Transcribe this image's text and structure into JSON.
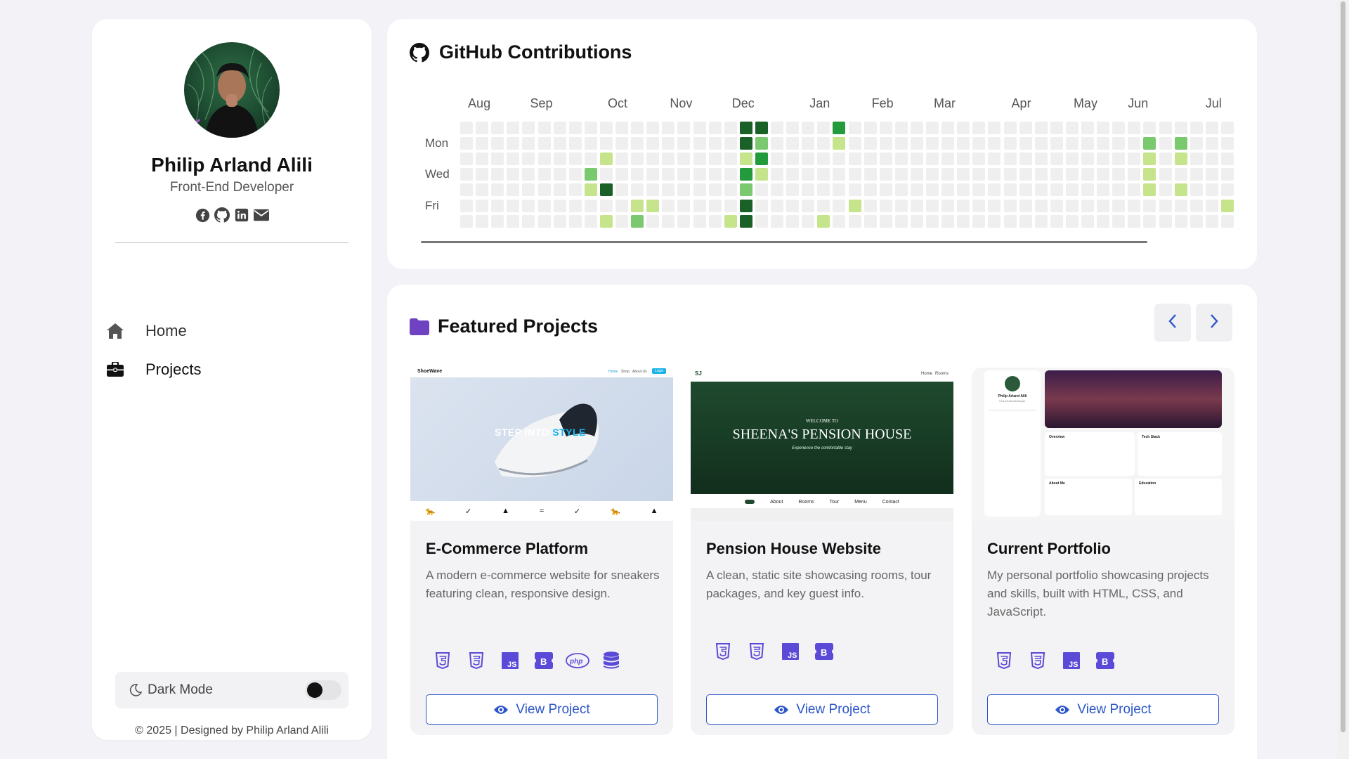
{
  "profile": {
    "name": "Philip Arland Alili",
    "role": "Front-End Developer"
  },
  "nav": {
    "home": "Home",
    "projects": "Projects"
  },
  "dark_mode": {
    "label": "Dark Mode",
    "enabled": false
  },
  "copyright": "© 2025 | Designed by Philip Arland Alili",
  "github": {
    "title": "GitHub Contributions",
    "months": [
      "Aug",
      "Sep",
      "Oct",
      "Nov",
      "Dec",
      "Jan",
      "Feb",
      "Mar",
      "Apr",
      "May",
      "Jun",
      "Jul"
    ],
    "days": [
      "Mon",
      "Wed",
      "Fri"
    ],
    "weeks": 50,
    "contributions": [
      {
        "w": 8,
        "d": 3,
        "l": 2
      },
      {
        "w": 8,
        "d": 4,
        "l": 1
      },
      {
        "w": 9,
        "d": 2,
        "l": 1
      },
      {
        "w": 9,
        "d": 4,
        "l": 4
      },
      {
        "w": 9,
        "d": 6,
        "l": 1
      },
      {
        "w": 11,
        "d": 5,
        "l": 1
      },
      {
        "w": 11,
        "d": 6,
        "l": 2
      },
      {
        "w": 12,
        "d": 5,
        "l": 1
      },
      {
        "w": 17,
        "d": 6,
        "l": 1
      },
      {
        "w": 18,
        "d": 0,
        "l": 4
      },
      {
        "w": 18,
        "d": 1,
        "l": 4
      },
      {
        "w": 18,
        "d": 2,
        "l": 1
      },
      {
        "w": 18,
        "d": 3,
        "l": 3
      },
      {
        "w": 18,
        "d": 4,
        "l": 2
      },
      {
        "w": 18,
        "d": 5,
        "l": 4
      },
      {
        "w": 18,
        "d": 6,
        "l": 4
      },
      {
        "w": 19,
        "d": 0,
        "l": 4
      },
      {
        "w": 19,
        "d": 1,
        "l": 2
      },
      {
        "w": 19,
        "d": 2,
        "l": 3
      },
      {
        "w": 19,
        "d": 3,
        "l": 1
      },
      {
        "w": 23,
        "d": 6,
        "l": 1
      },
      {
        "w": 24,
        "d": 0,
        "l": 3
      },
      {
        "w": 24,
        "d": 1,
        "l": 1
      },
      {
        "w": 25,
        "d": 5,
        "l": 1
      },
      {
        "w": 44,
        "d": 1,
        "l": 2
      },
      {
        "w": 44,
        "d": 2,
        "l": 1
      },
      {
        "w": 44,
        "d": 3,
        "l": 1
      },
      {
        "w": 44,
        "d": 4,
        "l": 1
      },
      {
        "w": 46,
        "d": 1,
        "l": 2
      },
      {
        "w": 46,
        "d": 2,
        "l": 1
      },
      {
        "w": 46,
        "d": 4,
        "l": 1
      },
      {
        "w": 49,
        "d": 5,
        "l": 1
      }
    ],
    "level_colors": [
      "#efefef",
      "#c6e48b",
      "#7bc96f",
      "#239a3b",
      "#196127"
    ]
  },
  "projects": {
    "title": "Featured Projects",
    "view_label": "View Project",
    "items": [
      {
        "title": "E-Commerce Platform",
        "description": "A modern e-commerce website for sneakers featuring clean, responsive design.",
        "tech": [
          "html5-icon",
          "css3-icon",
          "javascript-icon",
          "bootstrap-icon",
          "php-icon",
          "database-icon"
        ],
        "shot": {
          "brand": "ShoeWave",
          "menu": [
            "Home",
            "Shop",
            "About Us",
            "Login"
          ],
          "headline_1": "STEP INTO ",
          "headline_2": "STYLE"
        }
      },
      {
        "title": "Pension House Website",
        "description": "A clean, static site showcasing rooms, tour packages, and key guest info.",
        "tech": [
          "html5-icon",
          "css3-icon",
          "javascript-icon",
          "bootstrap-icon"
        ],
        "shot": {
          "brand": "SJ",
          "menu": [
            "Home",
            "Rooms"
          ],
          "welcome": "WELCOME TO",
          "headline": "SHEENA'S PENSION HOUSE",
          "tagline": "Experience the comfortable stay",
          "subnav": [
            "About",
            "Rooms",
            "Tour",
            "Menu",
            "Contact"
          ]
        }
      },
      {
        "title": "Current Portfolio",
        "description": "My personal portfolio showcasing projects and skills, built with HTML, CSS, and JavaScript.",
        "tech": [
          "html5-icon",
          "css3-icon",
          "javascript-icon",
          "bootstrap-icon"
        ],
        "shot": {
          "name": "Philip Arland Alili",
          "role": "Front-End Developer",
          "overview": "Overview",
          "tech_stack": "Tech Stack",
          "about": "About Me",
          "education": "Education"
        }
      }
    ]
  },
  "colors": {
    "accent_blue": "#2b55c9",
    "icon_purple": "#5b4ad8",
    "folder_purple": "#6f42c1"
  }
}
